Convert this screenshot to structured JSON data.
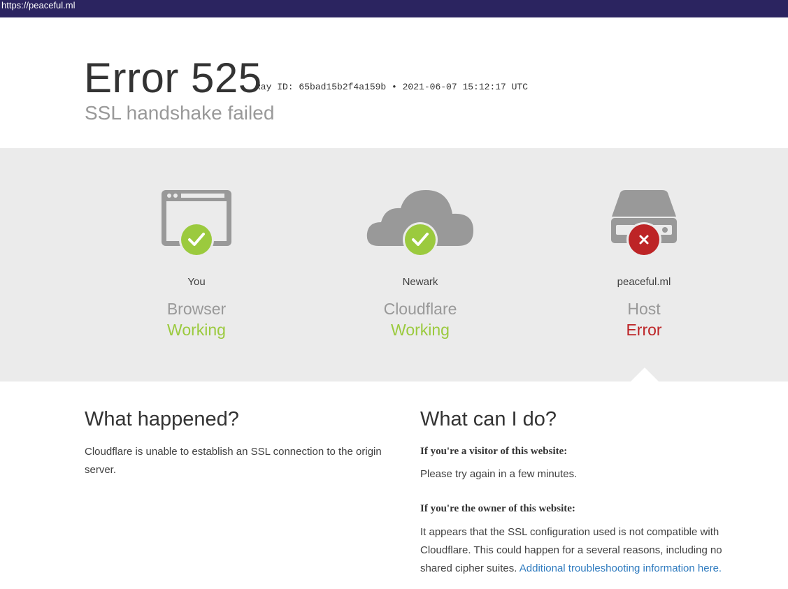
{
  "browser": {
    "url": "https://peaceful.ml"
  },
  "header": {
    "title": "Error 525",
    "ray_id": "Ray ID: 65bad15b2f4a159b • 2021-06-07 15:12:17 UTC",
    "subtitle": "SSL handshake failed"
  },
  "status": [
    {
      "location": "You",
      "kind": "Browser",
      "state": "Working",
      "icon": "browser-icon",
      "badge": "check-icon",
      "color": "#9bca3e"
    },
    {
      "location": "Newark",
      "kind": "Cloudflare",
      "state": "Working",
      "icon": "cloud-icon",
      "badge": "check-icon",
      "color": "#9bca3e"
    },
    {
      "location": "peaceful.ml",
      "kind": "Host",
      "state": "Error",
      "icon": "server-icon",
      "badge": "x-icon",
      "color": "#bd2426"
    }
  ],
  "what_happened": {
    "heading": "What happened?",
    "text": "Cloudflare is unable to establish an SSL connection to the origin server."
  },
  "what_can_i_do": {
    "heading": "What can I do?",
    "visitor_heading": "If you're a visitor of this website:",
    "visitor_text": "Please try again in a few minutes.",
    "owner_heading": "If you're the owner of this website:",
    "owner_text": "It appears that the SSL configuration used is not compatible with Cloudflare. This could happen for a several reasons, including no shared cipher suites.",
    "owner_link": "Additional troubleshooting information here."
  }
}
